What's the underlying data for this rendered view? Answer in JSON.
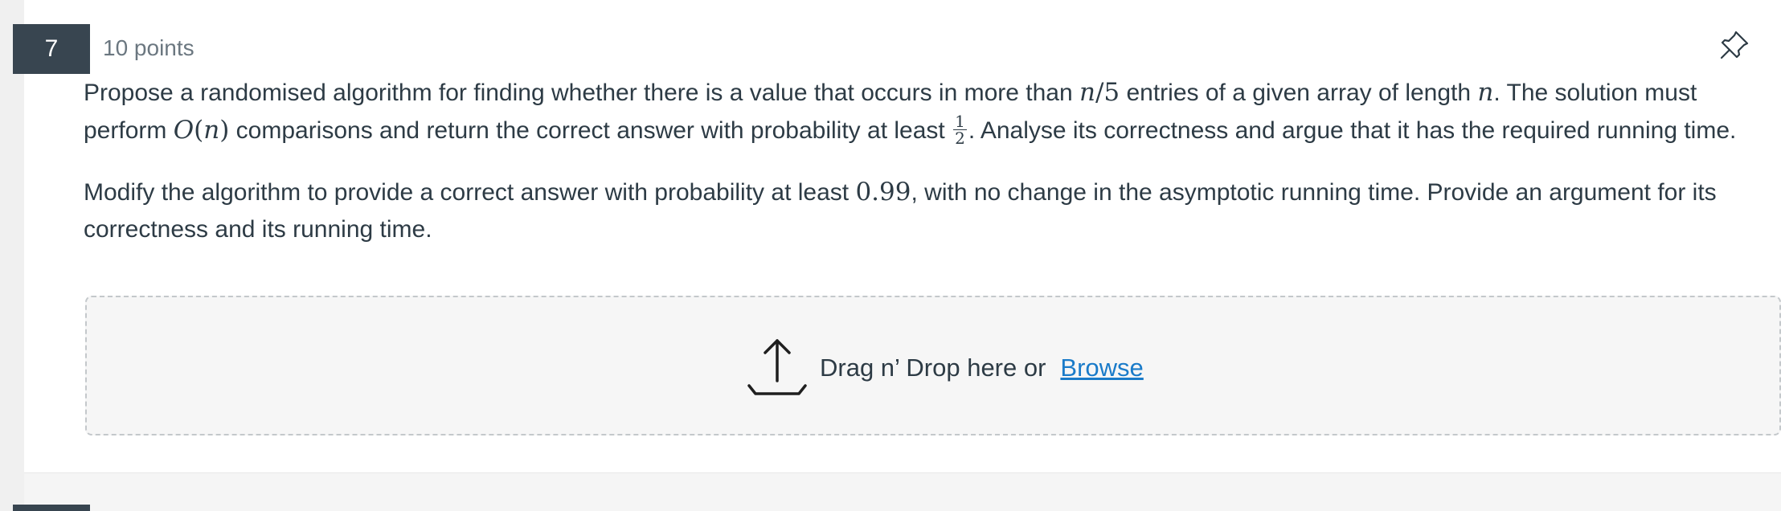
{
  "question": {
    "number": "7",
    "points": "10 points",
    "paragraph1": {
      "t1": "Propose a randomised algorithm for finding whether there is a value that occurs in more than ",
      "m1": "n",
      "m1b": "/5",
      "t2": " entries of a given array of length ",
      "m2": "n",
      "t3": ". The solution must perform ",
      "m3a": "O",
      "m3b": "(",
      "m3c": "n",
      "m3d": ")",
      "t4": " comparisons and return the correct answer with probability at least ",
      "frac_num": "1",
      "frac_den": "2",
      "t5": ". Analyse its correctness and argue that it has the required running time."
    },
    "paragraph2": {
      "t1": "Modify the algorithm to provide a correct answer with probability at least ",
      "m1": "0.99",
      "t2": ", with no change in the asymptotic running time. Provide an argument for its correctness and its running time."
    }
  },
  "upload": {
    "prompt": "Drag n’ Drop here or",
    "browse_label": "Browse",
    "icon": "upload-icon"
  },
  "icons": {
    "pin": "pin-icon"
  },
  "colors": {
    "badge": "#384550",
    "link": "#1a7bc9",
    "text": "#2d3b45",
    "muted": "#6b7780"
  }
}
